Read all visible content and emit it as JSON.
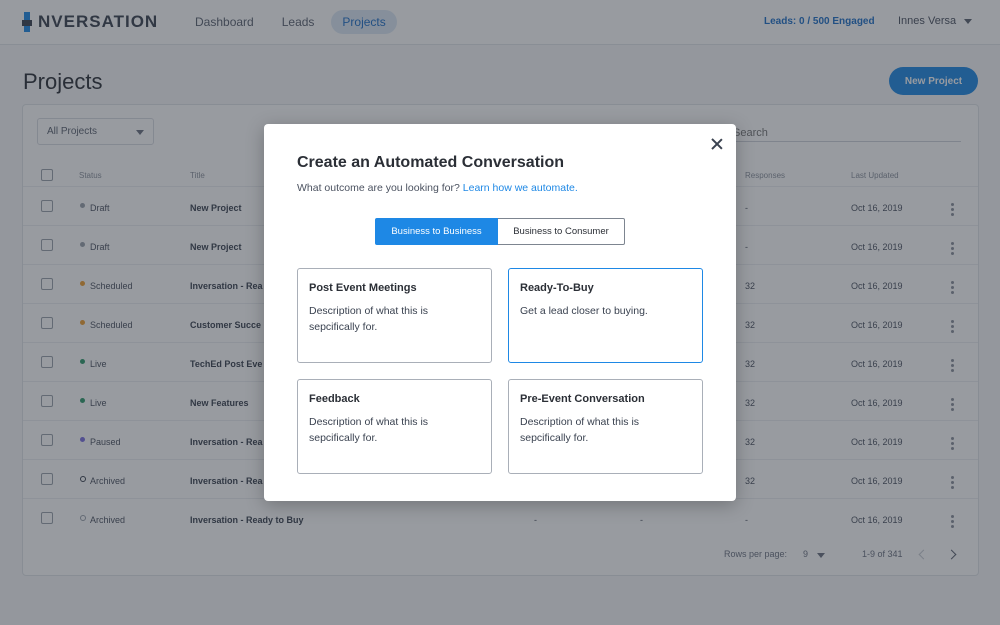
{
  "app": {
    "logo_text": "NVERSATION",
    "nav": [
      "Dashboard",
      "Leads",
      "Projects"
    ],
    "leads_status": "Leads: 0 / 500 Engaged",
    "user_name": "Innes Versa"
  },
  "page": {
    "title": "Projects",
    "new_project_label": "New Project",
    "filter_value": "All Projects",
    "search_placeholder": "Search"
  },
  "table": {
    "headers": {
      "status": "Status",
      "title": "Title",
      "responses": "Responses",
      "updated": "Last Updated"
    },
    "rows": [
      {
        "status": "Draft",
        "dot": "#9aa1ab",
        "ring": false,
        "title": "New Project",
        "c1": "",
        "c2": "",
        "responses": "-",
        "updated": "Oct 16, 2019"
      },
      {
        "status": "Draft",
        "dot": "#9aa1ab",
        "ring": false,
        "title": "New Project",
        "c1": "",
        "c2": "",
        "responses": "-",
        "updated": "Oct 16, 2019"
      },
      {
        "status": "Scheduled",
        "dot": "#f0a030",
        "ring": false,
        "title": "Inversation - Rea",
        "c1": "",
        "c2": "",
        "responses": "32",
        "updated": "Oct 16, 2019"
      },
      {
        "status": "Scheduled",
        "dot": "#f0a030",
        "ring": false,
        "title": "Customer Succe",
        "c1": "",
        "c2": "",
        "responses": "32",
        "updated": "Oct 16, 2019"
      },
      {
        "status": "Live",
        "dot": "#2e9a6b",
        "ring": false,
        "title": "TechEd Post Eve",
        "c1": "",
        "c2": "",
        "responses": "32",
        "updated": "Oct 16, 2019"
      },
      {
        "status": "Live",
        "dot": "#2e9a6b",
        "ring": false,
        "title": "New Features",
        "c1": "",
        "c2": "",
        "responses": "32",
        "updated": "Oct 16, 2019"
      },
      {
        "status": "Paused",
        "dot": "#7b6fe0",
        "ring": false,
        "title": "Inversation - Rea",
        "c1": "",
        "c2": "",
        "responses": "32",
        "updated": "Oct 16, 2019"
      },
      {
        "status": "Archived",
        "dot": "#3a4250",
        "ring": true,
        "title": "Inversation - Rea",
        "c1": "",
        "c2": "",
        "responses": "32",
        "updated": "Oct 16, 2019"
      },
      {
        "status": "Archived",
        "dot": "#9aa1ab",
        "ring": true,
        "title": "Inversation - Ready to Buy",
        "c1": "-",
        "c2": "-",
        "responses": "-",
        "updated": "Oct 16, 2019"
      }
    ],
    "rows_per_page_label": "Rows per page:",
    "rows_per_page_value": "9",
    "range_label": "1-9 of 341"
  },
  "modal": {
    "title": "Create an Automated Conversation",
    "subtitle": "What outcome are you looking for?",
    "link": "Learn how we automate.",
    "toggle": {
      "b2b": "Business to Business",
      "b2c": "Business to Consumer"
    },
    "options": [
      {
        "title": "Post Event Meetings",
        "desc": "Description of what this is sepcifically for."
      },
      {
        "title": "Ready-To-Buy",
        "desc": "Get a lead closer to buying."
      },
      {
        "title": "Feedback",
        "desc": "Description of what this is sepcifically for."
      },
      {
        "title": "Pre-Event Conversation",
        "desc": "Description of what this is sepcifically for."
      }
    ]
  },
  "colors": {
    "accent": "#1e88e5"
  }
}
